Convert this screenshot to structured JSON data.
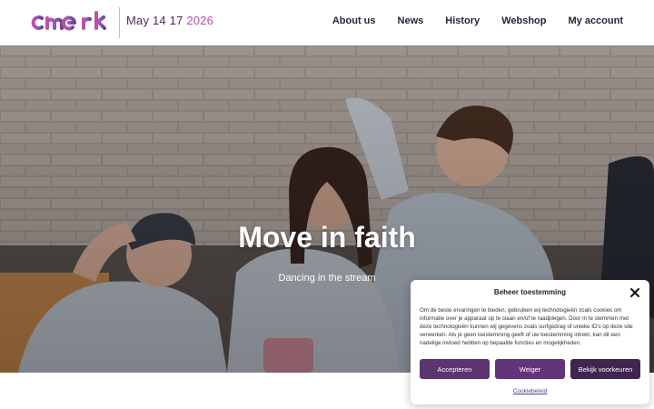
{
  "header": {
    "logo_alt": "emerk",
    "date_prefix": "May 14 17",
    "date_year": "2026",
    "nav": [
      {
        "label": "About us"
      },
      {
        "label": "News"
      },
      {
        "label": "History"
      },
      {
        "label": "Webshop"
      },
      {
        "label": "My account"
      }
    ]
  },
  "hero": {
    "title": "Move in faith",
    "subtitle": "Dancing in the stream"
  },
  "consent": {
    "title": "Beheer toestemming",
    "body": "Om de beste ervaringen te bieden, gebruiken wij technologieën zoals cookies om informatie over je apparaat op te slaan en/of te raadplegen. Door in te stemmen met deze technologieën kunnen wij gegevens zoals surfgedrag of unieke ID's op deze site verwerken. Als je geen toestemming geeft of uw toestemming intrekt, kan dit een nadelige invloed hebben op bepaalde functies en mogelijkheden.",
    "accept_label": "Accepteren",
    "deny_label": "Weiger",
    "prefs_label": "Bekijk voorkeuren",
    "policy_link": "Cookiebeleid"
  },
  "colors": {
    "brand_purple": "#5b3470",
    "brand_pink": "#b24fb1"
  }
}
